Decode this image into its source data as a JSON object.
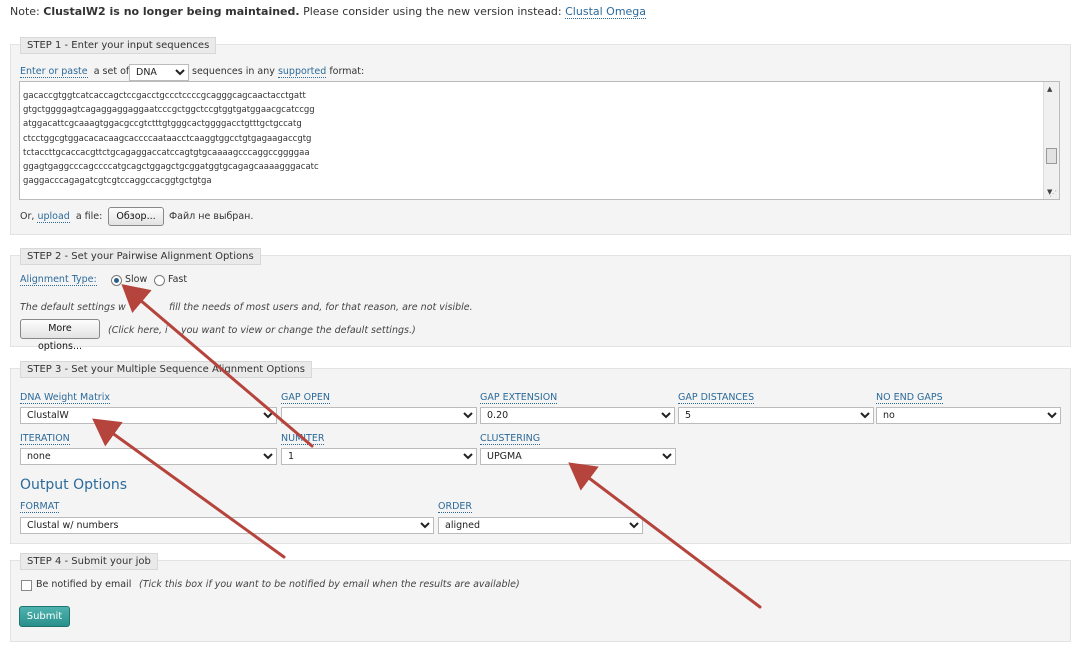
{
  "notice": {
    "prefix": "Note:",
    "bold": "ClustalW2 is no longer being maintained.",
    "text": "Please consider using the new version instead:",
    "link": "Clustal Omega"
  },
  "step1": {
    "legend": "STEP 1 - Enter your input sequences",
    "enter_link": "Enter or paste",
    "a_set_of": "a set of",
    "seq_type": "DNA",
    "sequences_in": "sequences in any",
    "supported_link": "supported",
    "format_suffix": "format:",
    "sequence_lines": [
      "gacaccgtggtcatcaccagctccgacctgccctccccgcagggcagcaactacctgatt",
      "gtgctggggagtcagaggaggaggaatcccgctggctccgtggtgatggaacgcatccgg",
      "atggacattcgcaaagtggacgccgtctttgtgggcactggggacctgtttgctgccatg",
      "ctcctggcgtggacacacaagcaccccaataacctcaaggtggcctgtgagaagaccgtg",
      "tctaccttgcaccacgttctgcagaggaccatccagtgtgcaaaagcccaggccggggaa",
      "ggagtgaggcccagccccatgcagctggagctgcggatggtgcagagcaaaagggacatc",
      "gaggacccagagatcgtcgtccaggccacggtgctgtga"
    ],
    "or": "Or,",
    "upload_link": "upload",
    "a_file": "a file:",
    "browse_button": "Обзор...",
    "no_file": "Файл не выбран."
  },
  "step2": {
    "legend": "STEP 2 - Set your Pairwise Alignment Options",
    "alignment_type_label": "Alignment Type:",
    "slow": "Slow",
    "fast": "Fast",
    "default_text_a": "The default settings w",
    "default_text_b": "fill the needs of most users and, for that reason, are not visible.",
    "more_button": "More options...",
    "click_text_a": "(Click here, i",
    "click_text_b": "you want to view or change the default settings.)"
  },
  "step3": {
    "legend": "STEP 3 - Set your Multiple Sequence Alignment Options",
    "dna_weight_label": "DNA Weight Matrix",
    "dna_weight_value": "ClustalW",
    "gap_open_label": "GAP OPEN",
    "gap_open_value": "",
    "gap_extension_label": "GAP EXTENSION",
    "gap_extension_value": "0.20",
    "gap_distances_label": "GAP DISTANCES",
    "gap_distances_value": "5",
    "no_end_gaps_label": "NO END GAPS",
    "no_end_gaps_value": "no",
    "iteration_label": "ITERATION",
    "iteration_value": "none",
    "numiter_label": "NUMITER",
    "numiter_value": "1",
    "clustering_label": "CLUSTERING",
    "clustering_value": "UPGMA",
    "output_title": "Output Options",
    "format_label": "FORMAT",
    "format_value": "Clustal w/ numbers",
    "order_label": "ORDER",
    "order_value": "aligned"
  },
  "step4": {
    "legend": "STEP 4 - Submit your job",
    "notify_label": "Be notified by email",
    "notify_hint": "(Tick this box if you want to be notified by email when the results are available)",
    "submit": "Submit"
  },
  "colors": {
    "link": "#2b6a9a",
    "arrow": "#b5443c",
    "submit": "#2a8f8b",
    "panel": "#f4f4f4"
  }
}
